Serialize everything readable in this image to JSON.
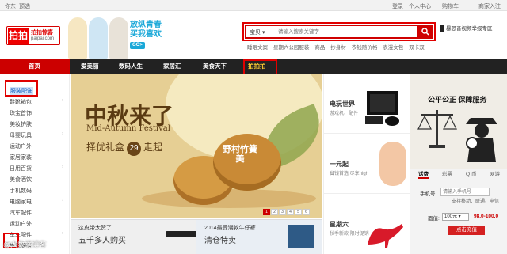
{
  "topbar": {
    "left": [
      "你东",
      "预选"
    ],
    "right": [
      "登录",
      "个人中心",
      "购物车",
      "商家入驻"
    ]
  },
  "logo": {
    "mark": "拍拍",
    "name": "拍拍惊喜",
    "domain": "paipai.com"
  },
  "promo": {
    "line1": "放纵青春",
    "line2": "买我喜欢",
    "go": "GO>"
  },
  "search": {
    "category": "宝贝",
    "placeholder": "请输入搜索关键字",
    "hotwords": [
      "睡眠文案",
      "星期六公园服装",
      "商品",
      "抄身材",
      "衣钱随价格",
      "表漫女包",
      "双卡双"
    ]
  },
  "qr": {
    "label": "暴恐音视频举报专区"
  },
  "nav": {
    "items": [
      "首页",
      "爱美丽",
      "数码人生",
      "家居汇",
      "美食天下",
      "拍拍拍"
    ],
    "active_index": 5,
    "active_color": "#ffcc33"
  },
  "sidebar": {
    "items": [
      "服装配饰",
      "鞋靴箱包",
      "珠宝首饰",
      "美妆护肤",
      "母婴玩具",
      "运动户外",
      "家居家装",
      "日用百货",
      "美食酒饮",
      "手机数码",
      "电脑家电",
      "汽车配件",
      "运动户外",
      "车车配件",
      "生活服务"
    ],
    "selected_index": 0
  },
  "banner": {
    "title": "中秋来了",
    "subtitle": "Mid-Autumn Festival",
    "line3_before": "择优礼盒",
    "line3_num": "29",
    "line3_after": "走起",
    "cake_text": "野村竹簧美",
    "pages": [
      "1",
      "2",
      "3",
      "4",
      "5",
      "6"
    ],
    "active_page": 0
  },
  "subbanners": [
    {
      "line1": "这皮带太赞了",
      "line2": "五千多人购买"
    },
    {
      "line1": "2014最受潮款牛仔裤",
      "line2": "清仓特卖"
    }
  ],
  "rightpanel": [
    {
      "title": "电玩世界",
      "desc": "游戏机、配件"
    },
    {
      "title": "一元起",
      "desc": "省钱首选 尽享high"
    },
    {
      "title": "星期六",
      "desc": "秋季新款 限时促销"
    }
  ],
  "side": {
    "title": "公平公正 保障服务",
    "tabs": [
      "话费",
      "彩票",
      "Q 币",
      "网游"
    ],
    "active_tab": 0,
    "phone_label": "手机号:",
    "phone_placeholder": "请输入手机号",
    "hint": "支持移动、联通、电信",
    "amount_label": "面值:",
    "amount_value": "100元",
    "price": "98.0-100.0",
    "button": "点击充值"
  },
  "watermark": "@大数据博客"
}
